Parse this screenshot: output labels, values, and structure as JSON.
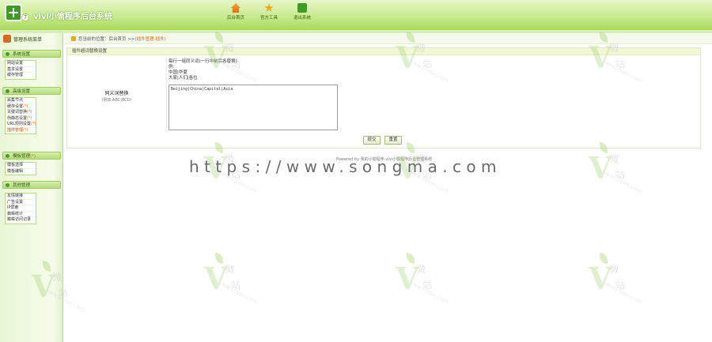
{
  "app": {
    "title": "vivi小偷程序后台系统",
    "badge": "7"
  },
  "topnav": {
    "items": [
      {
        "label": "后台首页",
        "icon": "home-icon"
      },
      {
        "label": "官方工具",
        "icon": "star-icon"
      },
      {
        "label": "退出系统",
        "icon": "rss-icon"
      }
    ]
  },
  "sidebar": {
    "title": "管理系统菜单",
    "groups": [
      {
        "label": "系统设置",
        "items": [
          "网站设置",
          "基本设置",
          "缓存管理"
        ]
      },
      {
        "label": "高级设置",
        "items": [
          "采集节点",
          "缓存设置",
          "关键词替换",
          "伪静态设置",
          "URL规则设置",
          "插件管理"
        ]
      },
      {
        "label": "模板管理",
        "items": [
          "模板选择",
          "模板编辑"
        ]
      },
      {
        "label": "其他管理",
        "items": [
          "友情链接",
          "广告设置",
          "IP屏蔽",
          "蜘蛛统计",
          "蜘蛛访问记录"
        ]
      }
    ],
    "group_mark": "(*)",
    "item_mark": "(*)"
  },
  "breadcrumb": {
    "prefix": "您当前的位置：后台首页 >>",
    "current": "(插件管理-插件)"
  },
  "panel": {
    "title": "插件超词替换设置",
    "field_label": "同义词替换",
    "field_sub": "(例如:ABC|BCD)",
    "hints": [
      "每行一组同义词(一行中前后各替换)",
      "例:",
      "中国|华夏",
      "大家|人们|各位"
    ],
    "textarea_value": "Beijing|China|Capital|Asia",
    "buttons": {
      "submit": "提交",
      "reset": "重置"
    }
  },
  "footer": {
    "text": "Powered by 我的小偷程序-vivi小偷程序后台管理系统"
  },
  "watermark": {
    "url": "https://www.songma.com",
    "logo_chars": [
      "微",
      "站"
    ],
    "logo_url": "www.vtoon.com"
  }
}
